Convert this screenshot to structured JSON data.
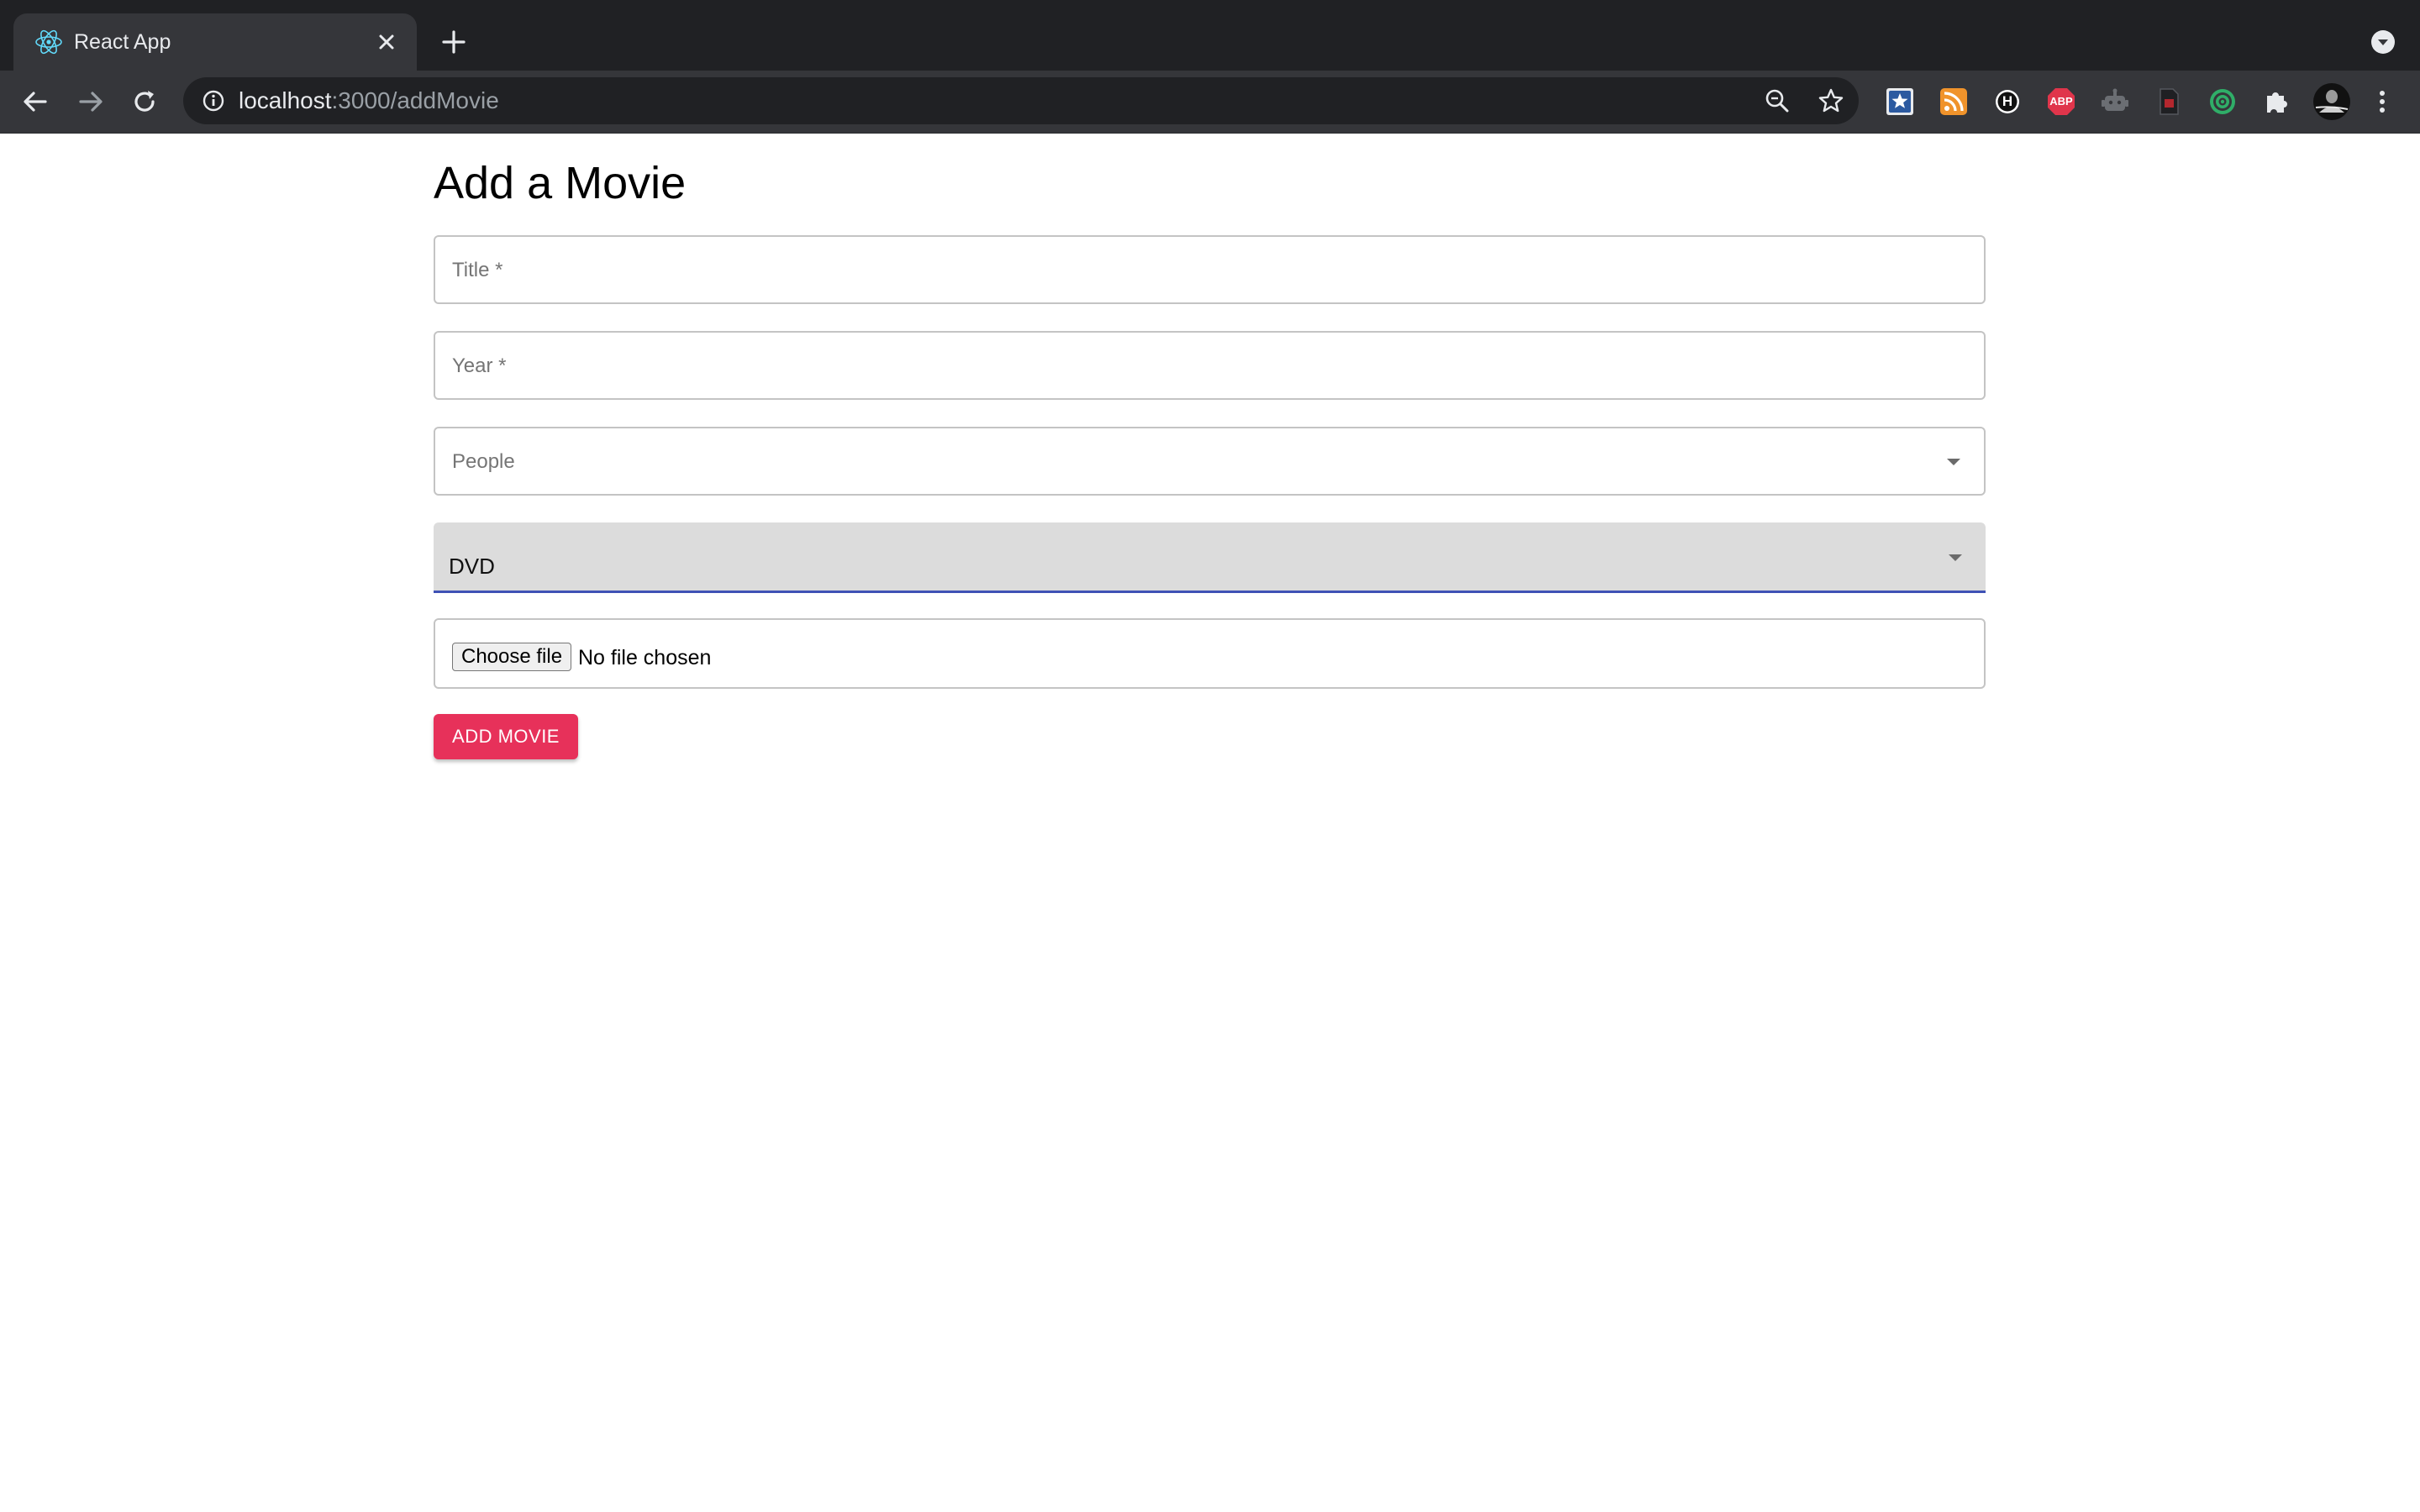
{
  "browser": {
    "tab": {
      "title": "React App",
      "favicon": "react-logo-icon"
    },
    "url": {
      "host": "localhost",
      "port_path": ":3000/addMovie"
    },
    "extensions": [
      "bookmark-star-icon",
      "rss-icon",
      "honey-icon",
      "adblock-plus-icon",
      "robot-icon",
      "pdf-icon",
      "target-icon",
      "puzzle-icon",
      "avatar"
    ],
    "extension_labels": {
      "adblock": "ABP",
      "honey": "H"
    }
  },
  "form": {
    "heading": "Add a Movie",
    "title_label": "Title *",
    "year_label": "Year *",
    "people_label": "People",
    "format_value": "DVD",
    "file_button": "Choose file",
    "file_status": "No file chosen",
    "submit_label": "ADD MOVIE"
  },
  "colors": {
    "accent": "#3f51b5",
    "submit": "#e7315a",
    "select_bg": "#dcdcdc",
    "chrome_dark": "#202124",
    "chrome_toolbar": "#35363a"
  }
}
